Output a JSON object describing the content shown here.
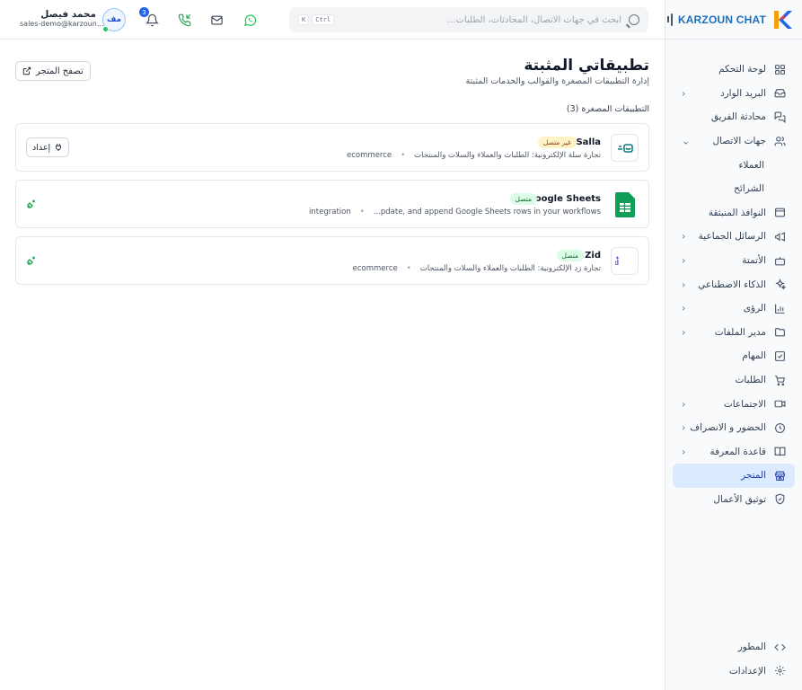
{
  "brand": {
    "name": "KARZOUN CHAT"
  },
  "header": {
    "search_placeholder": "ابحث في جهات الاتصال، المحادثات، الطلبات...",
    "kbd_ctrl": "Ctrl",
    "kbd_k": "K",
    "notification_count": "3",
    "user_name": "محمد فيصل",
    "user_email": "sales-demo@karzoun...",
    "avatar_initials": "مف"
  },
  "sidebar": {
    "items": [
      {
        "label": "لوحة التحكم",
        "icon": "dashboard-icon"
      },
      {
        "label": "البريد الوارد",
        "icon": "inbox-icon",
        "expandable": true
      },
      {
        "label": "محادثة الفريق",
        "icon": "team-chat-icon"
      },
      {
        "label": "جهات الاتصال",
        "icon": "contacts-icon",
        "expanded": true
      },
      {
        "label": "العملاء",
        "sub": true
      },
      {
        "label": "الشرائح",
        "sub": true
      },
      {
        "label": "النوافذ المنبثقة",
        "icon": "popup-icon"
      },
      {
        "label": "الرسائل الجماعية",
        "icon": "megaphone-icon",
        "expandable": true
      },
      {
        "label": "الأتمتة",
        "icon": "bot-icon",
        "expandable": true
      },
      {
        "label": "الذكاء الاصطناعي",
        "icon": "sparkles-icon",
        "expandable": true
      },
      {
        "label": "الرؤى",
        "icon": "chart-icon",
        "expandable": true
      },
      {
        "label": "مدير الملفات",
        "icon": "folder-icon",
        "expandable": true
      },
      {
        "label": "المهام",
        "icon": "task-icon"
      },
      {
        "label": "الطلبات",
        "icon": "cart-icon"
      },
      {
        "label": "الاجتماعات",
        "icon": "video-icon",
        "expandable": true
      },
      {
        "label": "الحضور و الانصراف",
        "icon": "clock-icon",
        "expandable": true
      },
      {
        "label": "قاعدة المعرفة",
        "icon": "book-icon",
        "expandable": true
      },
      {
        "label": "المتجر",
        "icon": "store-icon",
        "active": true
      },
      {
        "label": "توثيق الأعمال",
        "icon": "shield-icon"
      }
    ],
    "bottom": [
      {
        "label": "المطور",
        "icon": "code-icon"
      },
      {
        "label": "الإعدادات",
        "icon": "settings-icon"
      }
    ]
  },
  "main": {
    "title": "تطبيقاتي المثبتة",
    "subtitle": "إدارة التطبيقات المصغرة والقوالب والخدمات المثبتة",
    "browse_store": "تصفح المتجر",
    "section_title": "التطبيقات المصغرة (3)",
    "apps": [
      {
        "name": "Salla",
        "status": "غير متصل",
        "status_type": "off",
        "description": "تجارة سلة الإلكترونية: الطلبات والعملاء والسلات والمنتجات",
        "category": "ecommerce",
        "action": "إعداد"
      },
      {
        "name": "Google Sheets",
        "status": "متصل",
        "status_type": "on",
        "description": "...pdate, and append Google Sheets rows in your workflows",
        "category": "integration"
      },
      {
        "name": "Zid",
        "status": "متصل",
        "status_type": "on",
        "description": "تجارة زد الإلكترونية: الطلبات والعملاء والسلات والمنتجات",
        "category": "ecommerce"
      }
    ]
  },
  "colors": {
    "accent": "#2563eb",
    "active_bg": "#dbeafe",
    "whatsapp": "#22c55e",
    "sheets": "#0f9d58",
    "zid": "#7c3aed",
    "salla": "#0e7f80"
  }
}
